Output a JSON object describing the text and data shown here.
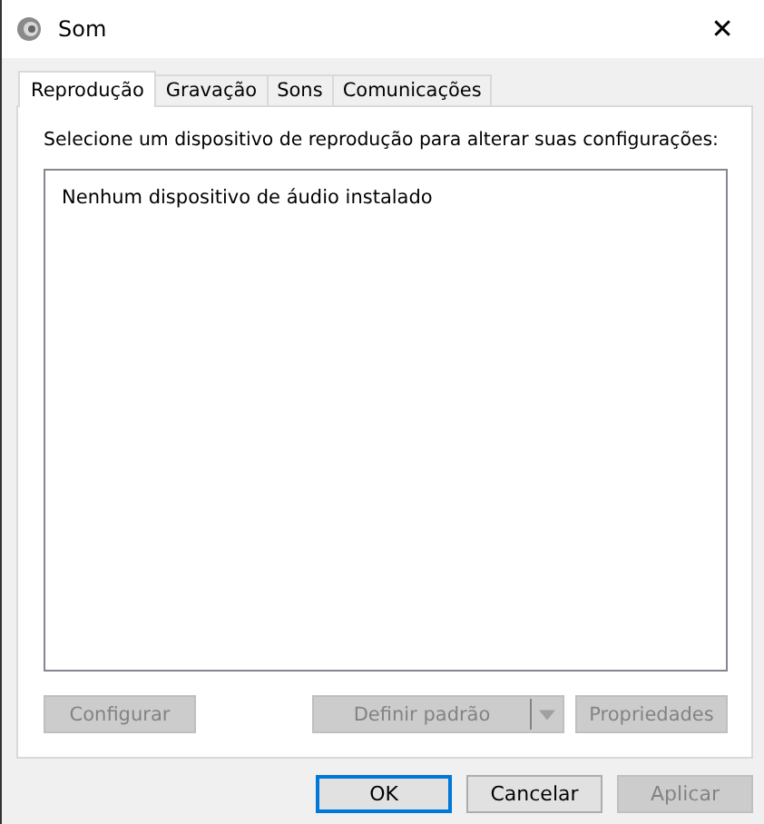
{
  "window": {
    "title": "Som",
    "close": "✕"
  },
  "tabs": [
    {
      "label": "Reprodução",
      "selected": true
    },
    {
      "label": "Gravação",
      "selected": false
    },
    {
      "label": "Sons",
      "selected": false
    },
    {
      "label": "Comunicações",
      "selected": false
    }
  ],
  "instruction": "Selecione um dispositivo de reprodução para alterar suas configurações:",
  "device_list": {
    "empty_message": "Nenhum dispositivo de áudio instalado"
  },
  "panel_buttons": [
    {
      "label": "Configurar",
      "kind": "plain",
      "disabled": true
    },
    {
      "label": "Definir padrão",
      "kind": "split",
      "disabled": true
    },
    {
      "label": "Propriedades",
      "kind": "plain",
      "disabled": true
    }
  ],
  "dialog_buttons": [
    {
      "label": "OK",
      "disabled": false,
      "default": true
    },
    {
      "label": "Cancelar",
      "disabled": false,
      "default": false
    },
    {
      "label": "Aplicar",
      "disabled": true,
      "default": false
    }
  ]
}
